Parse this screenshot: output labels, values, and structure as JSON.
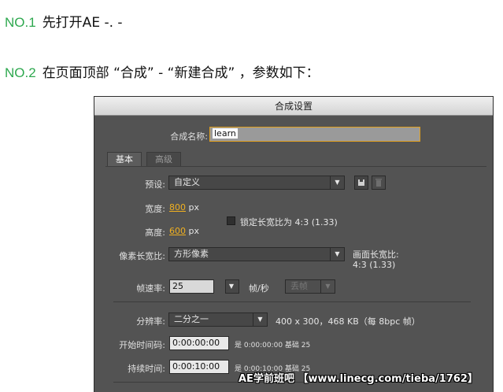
{
  "steps": [
    {
      "num": "NO.1",
      "text": "先打开AE   -. -"
    },
    {
      "num": "NO.2",
      "text": "在页面顶部 “合成” - “新建合成” ，参数如下："
    }
  ],
  "dialog": {
    "title": "合成设置",
    "comp_name_label": "合成名称:",
    "comp_name_value": "learn",
    "tabs": [
      "基本",
      "高级"
    ],
    "preset_label": "预设:",
    "preset_value": "自定义",
    "width_label": "宽度:",
    "width_value": "800",
    "width_unit": "px",
    "height_label": "高度:",
    "height_value": "600",
    "height_unit": "px",
    "lock_aspect_label": "锁定长宽比为 4:3 (1.33)",
    "pixel_aspect_label": "像素长宽比:",
    "pixel_aspect_value": "方形像素",
    "frame_aspect_label": "画面长宽比:",
    "frame_aspect_value": "4:3 (1.33)",
    "frame_rate_label": "帧速率:",
    "frame_rate_value": "25",
    "frame_rate_unit": "帧/秒",
    "drop_frame_value": "丢帧",
    "resolution_label": "分辨率:",
    "resolution_value": "二分之一",
    "resolution_info": "400 x 300，468 KB（每 8bpc 帧）",
    "start_timecode_label": "开始时间码:",
    "start_timecode_value": "0:00:00:00",
    "start_timecode_info": "是 0:00:00:00  基础 25",
    "duration_label": "持续时间:",
    "duration_value": "0:00:10:00",
    "duration_info": "是 0:00:10:00  基础 25"
  },
  "watermark": "AE学前班吧  【www.linecg.com/tieba/1762】",
  "colors": {
    "accent_green": "#2ea84f",
    "link_orange": "#f0b020",
    "dialog_bg": "#535353"
  }
}
